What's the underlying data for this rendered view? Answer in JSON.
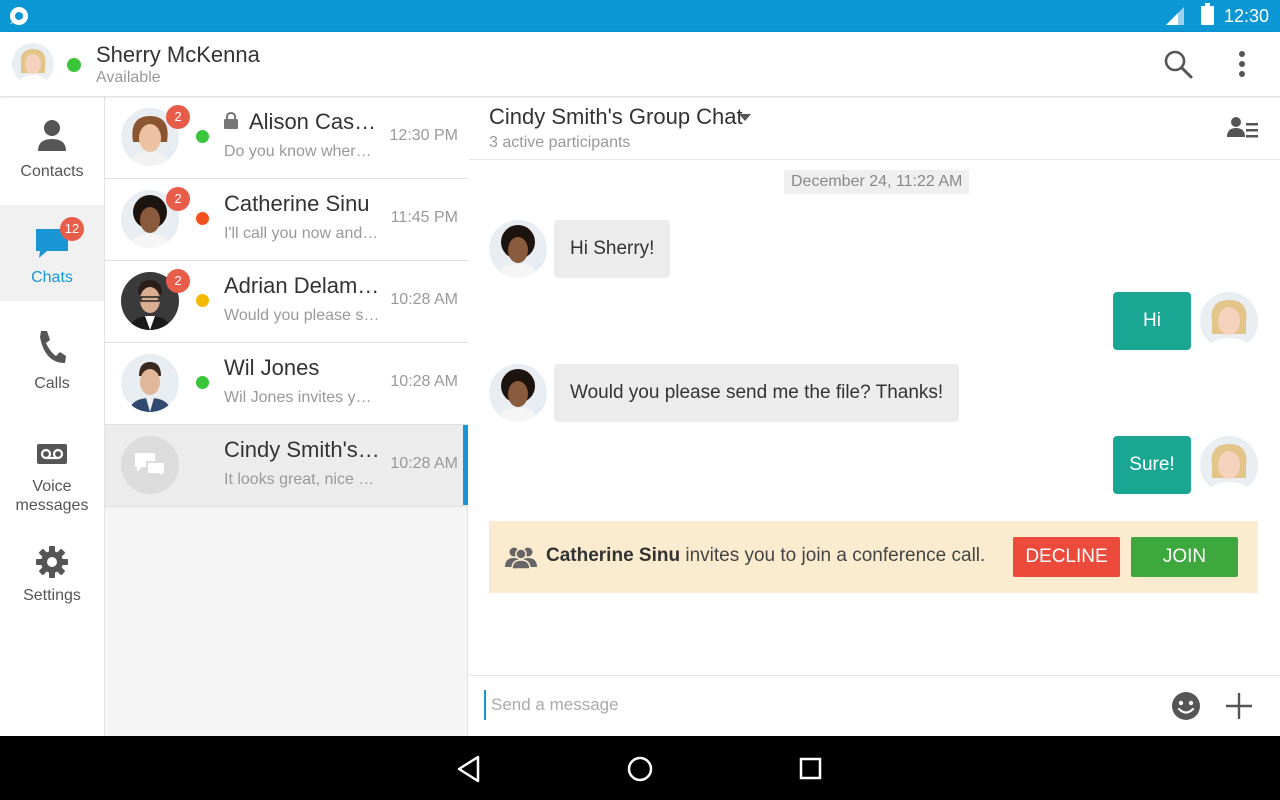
{
  "status_bar": {
    "time": "12:30"
  },
  "header": {
    "user_name": "Sherry McKenna",
    "user_status": "Available"
  },
  "nav": {
    "items": [
      {
        "label": "Contacts",
        "icon": "person-icon"
      },
      {
        "label": "Chats",
        "icon": "chat-bubble-icon",
        "badge": "12",
        "active": true
      },
      {
        "label": "Calls",
        "icon": "phone-icon"
      },
      {
        "label": "Voice\nmessages",
        "icon": "voicemail-icon"
      },
      {
        "label": "Settings",
        "icon": "gear-icon"
      }
    ]
  },
  "chats": [
    {
      "name": "Alison Cassidy",
      "preview": "Do you know where's the meeting?",
      "time": "12:30 PM",
      "badge": "2",
      "presence": "#3bc53b",
      "locked": true
    },
    {
      "name": "Catherine Sinu",
      "preview": "I'll call you now and we'll talk",
      "time": "11:45 PM",
      "badge": "2",
      "presence": "#f4511e"
    },
    {
      "name": "Adrian Delamico",
      "preview": "Would you please send me the file?",
      "time": "10:28 AM",
      "badge": "2",
      "presence": "#f5b800"
    },
    {
      "name": "Wil Jones",
      "preview": "Wil Jones invites you to a call",
      "time": "10:28 AM",
      "presence": "#3bc53b"
    },
    {
      "name": "Cindy Smith's Group Chat",
      "preview": "It looks great, nice work!",
      "time": "10:28 AM",
      "selected": true
    }
  ],
  "conversation": {
    "title": "Cindy Smith's Group Chat",
    "subtitle": "3 active participants",
    "date_divider": "December 24, 11:22 AM",
    "messages": [
      {
        "direction": "in",
        "text": "Hi Sherry!"
      },
      {
        "direction": "out",
        "text": "Hi"
      },
      {
        "direction": "in",
        "text": "Would you please send me the file? Thanks!"
      },
      {
        "direction": "out",
        "text": "Sure!"
      }
    ],
    "invite": {
      "from": "Catherine Sinu",
      "text": " invites you to join a conference call.",
      "decline_label": "DECLINE",
      "join_label": "JOIN"
    }
  },
  "composer": {
    "placeholder": "Send a message"
  },
  "colors": {
    "accent": "#1a96d4",
    "outgoing_bubble": "#19a794",
    "decline": "#ec4a3b",
    "join": "#3ca83e",
    "invite_bg": "#fbecd0",
    "badge": "#e85c4a"
  }
}
